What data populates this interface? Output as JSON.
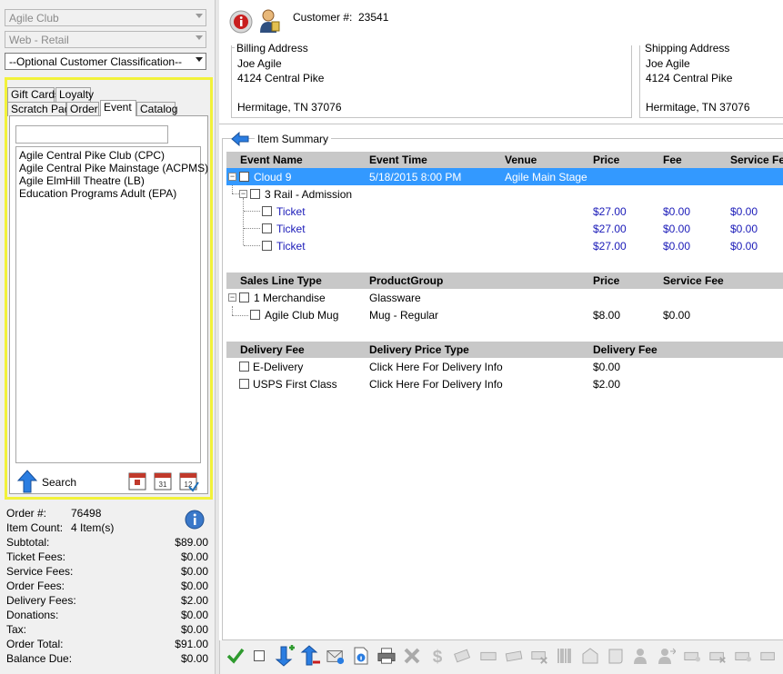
{
  "left": {
    "dropdowns": [
      {
        "value": "Agile Club",
        "active": false
      },
      {
        "value": "Web - Retail",
        "active": false
      },
      {
        "value": "--Optional Customer Classification--",
        "active": true
      }
    ],
    "tabs_row1": [
      "Gift Cards",
      "Loyalty"
    ],
    "tabs_row2": [
      "Scratch Pad",
      "Order",
      "Event",
      "Catalog"
    ],
    "selected_tab": "Event",
    "search_value": "",
    "events": [
      "Agile Central Pike Club  (CPC)",
      "Agile Central Pike Mainstage  (ACPMS)",
      "Agile ElmHill Theatre  (LB)",
      "Education Programs Adult  (EPA)"
    ],
    "search_label": "Search",
    "summary": {
      "order_num_label": "Order #:",
      "order_num": "76498",
      "item_count_label": "Item Count:",
      "item_count": "4 Item(s)",
      "rows": [
        {
          "label": "Subtotal:",
          "value": "$89.00"
        },
        {
          "label": "Ticket Fees:",
          "value": "$0.00"
        },
        {
          "label": "Service Fees:",
          "value": "$0.00"
        },
        {
          "label": "Order Fees:",
          "value": "$0.00"
        },
        {
          "label": "Delivery Fees:",
          "value": "$2.00"
        },
        {
          "label": "Donations:",
          "value": "$0.00"
        },
        {
          "label": "Tax:",
          "value": "$0.00"
        },
        {
          "label": "Order Total:",
          "value": "$91.00"
        },
        {
          "label": "Balance Due:",
          "value": "$0.00"
        }
      ]
    }
  },
  "customer": {
    "label": "Customer #:",
    "number": "23541"
  },
  "billing": {
    "title": "Billing Address",
    "name": "Joe Agile",
    "street": "4124 Central Pike",
    "city": "Hermitage, TN 37076"
  },
  "shipping": {
    "title": "Shipping Address",
    "name": "Joe Agile",
    "street": "4124 Central Pike",
    "city": "Hermitage, TN 37076"
  },
  "item_summary": {
    "title": "Item Summary",
    "event_headers": [
      "Event Name",
      "Event Time",
      "Venue",
      "Price",
      "Fee",
      "Service Fe"
    ],
    "event": {
      "name": "Cloud 9",
      "time": "5/18/2015 8:00 PM",
      "venue": "Agile Main Stage"
    },
    "price_level": "3 Rail - Admission",
    "tickets": [
      {
        "label": "Ticket",
        "price": "$27.00",
        "fee": "$0.00",
        "service": "$0.00"
      },
      {
        "label": "Ticket",
        "price": "$27.00",
        "fee": "$0.00",
        "service": "$0.00"
      },
      {
        "label": "Ticket",
        "price": "$27.00",
        "fee": "$0.00",
        "service": "$0.00"
      }
    ],
    "sales_headers": [
      "Sales Line Type",
      "ProductGroup",
      "Price",
      "Service Fee"
    ],
    "merch": {
      "label": "1 Merchandise",
      "group": "Glassware"
    },
    "merch_item": {
      "label": "Agile Club Mug",
      "group": "Mug - Regular",
      "price": "$8.00",
      "service": "$0.00"
    },
    "delivery_headers": [
      "Delivery Fee",
      "Delivery Price Type",
      "Delivery Fee"
    ],
    "delivery": [
      {
        "label": "E-Delivery",
        "type": "Click Here For Delivery Info",
        "fee": "$0.00"
      },
      {
        "label": "USPS First Class",
        "type": "Click Here For Delivery Info",
        "fee": "$2.00"
      }
    ]
  },
  "colors": {
    "selection": "#3399ff",
    "highlight": "#f2f23a",
    "link_blue": "#1a1ab8",
    "header_gray": "#c8c8c8"
  }
}
